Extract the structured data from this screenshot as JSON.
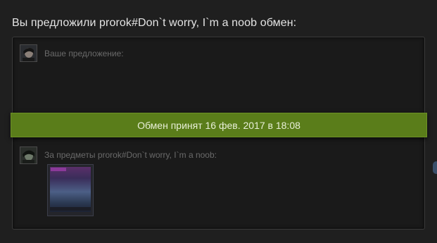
{
  "heading": "Вы предложили prorok#Don`t worry, I`m a noob обмен:",
  "your_offer": {
    "label": "Ваше предложение:",
    "avatar": "user-avatar"
  },
  "status_banner": {
    "text": "Обмен принят 16 фев. 2017 в 18:08",
    "color": "#5a7d1a"
  },
  "their_items": {
    "label": "За предметы prorok#Don`t worry, I`m a noob:",
    "avatar": "partner-avatar",
    "items": [
      {
        "icon": "game-item-thumbnail"
      }
    ]
  }
}
